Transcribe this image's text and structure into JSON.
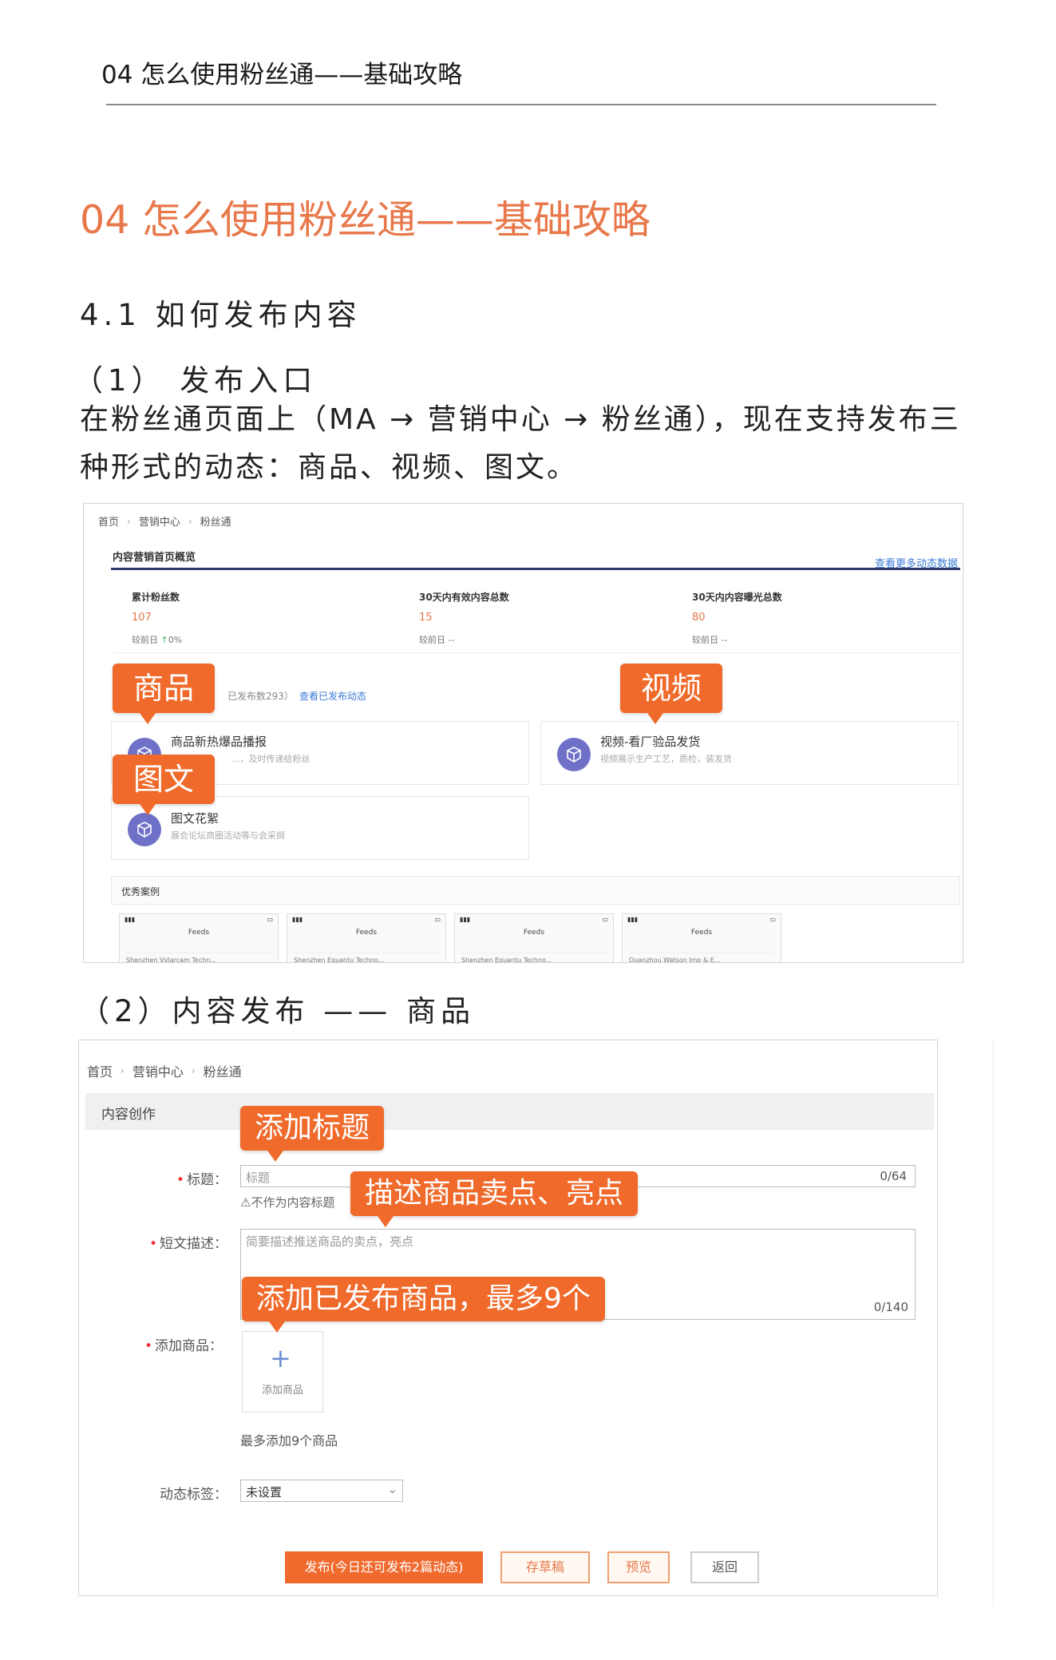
{
  "doc": {
    "running_header": "04 怎么使用粉丝通——基础攻略",
    "heading": "04 怎么使用粉丝通——基础攻略",
    "section_4_1": "4.1 如何发布内容",
    "step1_title": "（1） 发布入口",
    "step1_text": "在粉丝通页面上（MA → 营销中心 → 粉丝通），现在支持发布三种形式的动态：商品、视频、图文。",
    "step2_title": "（2）内容发布 —— 商品"
  },
  "shot1": {
    "breadcrumb": [
      "首页",
      "营销中心",
      "粉丝通"
    ],
    "overview_title": "内容营销首页概览",
    "more_link": "查看更多动态数据",
    "stats": [
      {
        "label": "累计粉丝数",
        "value": "107",
        "compare": "较前日",
        "delta": "0%"
      },
      {
        "label": "30天内有效内容总数",
        "value": "15",
        "compare": "较前日 --"
      },
      {
        "label": "30天内内容曝光总数",
        "value": "80",
        "compare": "较前日 --"
      }
    ],
    "published_count": "已发布数293）",
    "published_link": "查看已发布动态",
    "cards": [
      {
        "title": "商品新热爆品播报",
        "desc": "...，及时传递给粉丝"
      },
      {
        "title": "视频-看厂验品发货",
        "desc": "视频展示生产工艺，质检，装发货"
      },
      {
        "title": "图文花絮",
        "desc": "展会论坛商圈活动等与会采撷"
      }
    ],
    "cases_title": "优秀案例",
    "phones": [
      {
        "title": "Feeds",
        "row": "Shenzhen Vstarcam Techn..."
      },
      {
        "title": "Feeds",
        "row": "Shenzhen Equantu Techno..."
      },
      {
        "title": "Feeds",
        "row": "Shenzhen Equantu Techno..."
      },
      {
        "title": "Feeds",
        "row": "Quanzhou Watson Imp & E..."
      }
    ],
    "callouts": {
      "goods": "商品",
      "video": "视频",
      "graphic": "图文"
    }
  },
  "shot2": {
    "breadcrumb": [
      "首页",
      "营销中心",
      "粉丝通"
    ],
    "section": "内容创作",
    "title_label": "标题：",
    "title_placeholder": "标题",
    "title_counter": "0/64",
    "title_hint": "⚠不作为内容标题",
    "desc_label": "短文描述：",
    "desc_placeholder": "简要描述推送商品的卖点，亮点",
    "desc_counter": "0/140",
    "goods_label": "添加商品：",
    "add_goods": "添加商品",
    "goods_hint": "最多添加9个商品",
    "tag_label": "动态标签：",
    "tag_value": "未设置",
    "btn_publish": "发布(今日还可发布2篇动态)",
    "btn_draft": "存草稿",
    "btn_preview": "预览",
    "btn_back": "返回",
    "callouts": {
      "title": "添加标题",
      "desc": "描述商品卖点、亮点",
      "goods": "添加已发布商品，最多9个"
    }
  },
  "colors": {
    "accent": "#e8774a",
    "callout": "#ef6a2b",
    "icon": "#6f70c8",
    "link": "#3a7bd5"
  }
}
